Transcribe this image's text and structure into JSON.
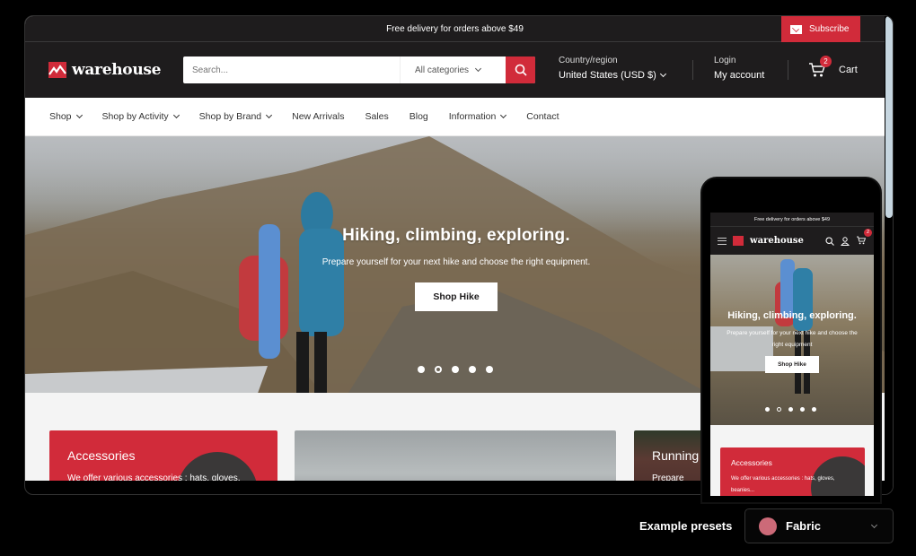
{
  "announcement": {
    "text": "Free delivery for orders above $49",
    "subscribe_label": "Subscribe"
  },
  "header": {
    "logo_text": "warehouse",
    "search_placeholder": "Search...",
    "category_label": "All categories",
    "country_label": "Country/region",
    "country_value": "United States (USD $)",
    "login_label": "Login",
    "account_label": "My account",
    "cart_label": "Cart",
    "cart_count": "2"
  },
  "nav": {
    "items": [
      {
        "label": "Shop",
        "dropdown": true
      },
      {
        "label": "Shop by Activity",
        "dropdown": true
      },
      {
        "label": "Shop by Brand",
        "dropdown": true
      },
      {
        "label": "New Arrivals",
        "dropdown": false
      },
      {
        "label": "Sales",
        "dropdown": false
      },
      {
        "label": "Blog",
        "dropdown": false
      },
      {
        "label": "Information",
        "dropdown": true
      },
      {
        "label": "Contact",
        "dropdown": false
      }
    ]
  },
  "hero": {
    "title": "Hiking, climbing, exploring.",
    "subtitle": "Prepare yourself for your next hike and choose the right equipment.",
    "button_label": "Shop Hike",
    "slide_count": 5,
    "active_slide": 2
  },
  "cards": [
    {
      "title": "Accessories",
      "description": "We offer various accessories :  hats, gloves,"
    },
    {
      "title": "",
      "description": ""
    },
    {
      "title": "Running",
      "description": "Prepare you"
    }
  ],
  "mobile": {
    "announcement": "Free delivery for orders above $49",
    "logo_text": "warehouse",
    "cart_count": "2",
    "hero_title": "Hiking, climbing, exploring.",
    "hero_subtitle": "Prepare yourself for your next hike and choose the right equipment",
    "hero_button": "Shop Hike",
    "card_title": "Accessories",
    "card_description": "We offer various accessories :  hats, gloves, beanies..."
  },
  "presets": {
    "label": "Example presets",
    "selected": "Fabric",
    "swatch_color": "#cc6a78"
  },
  "colors": {
    "accent": "#d12b3a",
    "header_bg": "#1e1c1d"
  }
}
